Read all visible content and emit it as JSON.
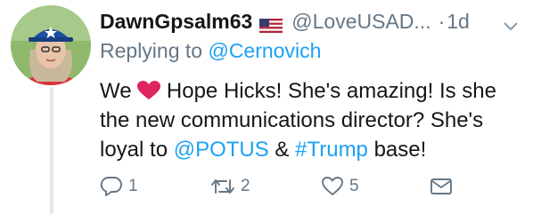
{
  "tweet": {
    "display_name": "DawnGpsalm63",
    "handle": "@LoveUSAD...",
    "separator": "·",
    "time": "1d",
    "replying_prefix": "Replying to ",
    "replying_to": "@Cernovich",
    "text": {
      "part1": "We ",
      "part2": " Hope Hicks! She's amazing! Is she the new communications director? She's loyal to ",
      "mention": "@POTUS",
      "part3": " & ",
      "hashtag": "#Trump",
      "part4": " base!"
    }
  },
  "actions": {
    "reply_count": "1",
    "retweet_count": "2",
    "like_count": "5"
  },
  "icons": {
    "flag": "us-flag-icon",
    "heart_emoji": "red-heart-icon",
    "chevron": "chevron-down-icon",
    "reply": "reply-icon",
    "retweet": "retweet-icon",
    "like": "like-icon",
    "dm": "direct-message-icon"
  },
  "colors": {
    "link": "#1da1f2",
    "secondary": "#657786",
    "text": "#14171a",
    "thread_line": "#e1e8ed",
    "heart": "#e0245e"
  }
}
